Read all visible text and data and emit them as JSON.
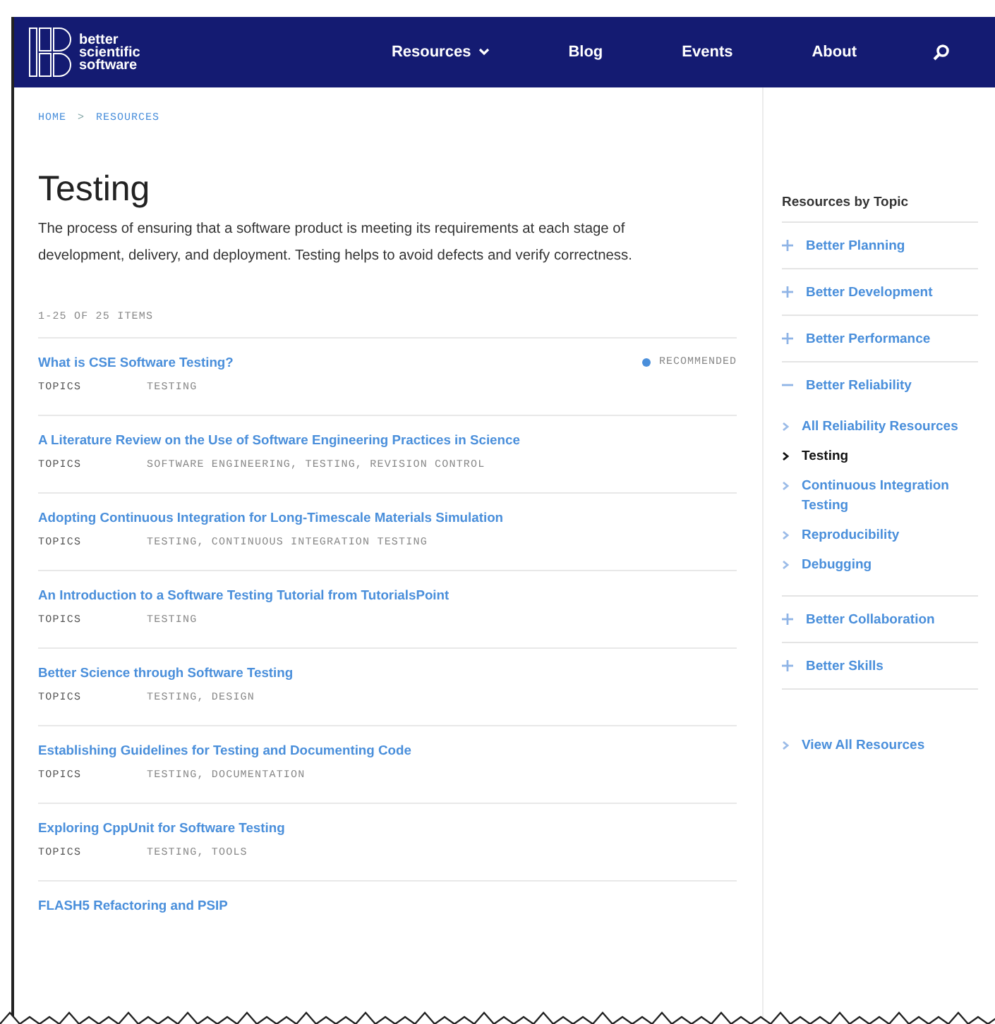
{
  "logo": {
    "lines": [
      "better",
      "scientific",
      "software"
    ]
  },
  "nav": [
    {
      "label": "Resources",
      "dropdown": true
    },
    {
      "label": "Blog",
      "dropdown": false
    },
    {
      "label": "Events",
      "dropdown": false
    },
    {
      "label": "About",
      "dropdown": false
    }
  ],
  "breadcrumb": [
    "HOME",
    "RESOURCES"
  ],
  "breadcrumb_separator": ">",
  "title": "Testing",
  "description": "The process of ensuring that a software product is meeting its requirements at each stage of development, delivery, and deployment. Testing helps to avoid defects and verify correctness.",
  "item_count": "1-25 OF 25 ITEMS",
  "items": [
    {
      "title": "What is CSE Software Testing?",
      "topics_label": "TOPICS",
      "topics": "TESTING",
      "badge": "RECOMMENDED"
    },
    {
      "title": "A Literature Review on the Use of Software Engineering Practices in Science",
      "topics_label": "TOPICS",
      "topics": "SOFTWARE ENGINEERING, TESTING, REVISION CONTROL"
    },
    {
      "title": "Adopting Continuous Integration for Long-Timescale Materials Simulation",
      "topics_label": "TOPICS",
      "topics": "TESTING, CONTINUOUS INTEGRATION TESTING"
    },
    {
      "title": "An Introduction to a Software Testing Tutorial from TutorialsPoint",
      "topics_label": "TOPICS",
      "topics": "TESTING"
    },
    {
      "title": "Better Science through Software Testing",
      "topics_label": "TOPICS",
      "topics": "TESTING, DESIGN"
    },
    {
      "title": "Establishing Guidelines for Testing and Documenting Code",
      "topics_label": "TOPICS",
      "topics": "TESTING, DOCUMENTATION"
    },
    {
      "title": "Exploring CppUnit for Software Testing",
      "topics_label": "TOPICS",
      "topics": "TESTING, TOOLS"
    },
    {
      "title": "FLASH5 Refactoring and PSIP"
    }
  ],
  "sidebar": {
    "heading": "Resources by Topic",
    "topics": [
      {
        "label": "Better Planning",
        "expanded": false
      },
      {
        "label": "Better Development",
        "expanded": false
      },
      {
        "label": "Better Performance",
        "expanded": false
      },
      {
        "label": "Better Reliability",
        "expanded": true,
        "children": [
          {
            "label": "All Reliability Resources",
            "selected": false
          },
          {
            "label": "Testing",
            "selected": true
          },
          {
            "label": "Continuous Integration Testing",
            "selected": false
          },
          {
            "label": "Reproducibility",
            "selected": false
          },
          {
            "label": "Debugging",
            "selected": false
          }
        ]
      },
      {
        "label": "Better Collaboration",
        "expanded": false
      },
      {
        "label": "Better Skills",
        "expanded": false
      }
    ],
    "view_all": "View All Resources"
  }
}
